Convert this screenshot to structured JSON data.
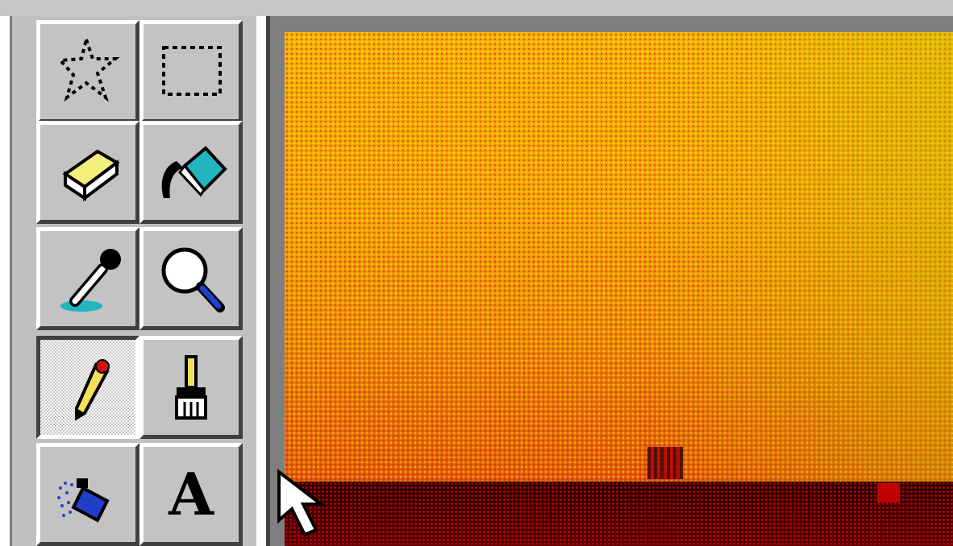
{
  "toolbox": {
    "tools": [
      {
        "name": "free-form-select",
        "icon": "free-form-select-icon",
        "selected": false
      },
      {
        "name": "rectangle-select",
        "icon": "rectangle-select-icon",
        "selected": false
      },
      {
        "name": "eraser",
        "icon": "eraser-icon",
        "selected": false
      },
      {
        "name": "fill-with-color",
        "icon": "paint-bucket-icon",
        "selected": false
      },
      {
        "name": "pick-color",
        "icon": "eyedropper-icon",
        "selected": false
      },
      {
        "name": "magnifier",
        "icon": "magnifier-icon",
        "selected": false
      },
      {
        "name": "pencil",
        "icon": "pencil-icon",
        "selected": true
      },
      {
        "name": "brush",
        "icon": "brush-icon",
        "selected": false
      },
      {
        "name": "airbrush",
        "icon": "airbrush-icon",
        "selected": false
      },
      {
        "name": "text",
        "icon": "text-icon",
        "label": "A",
        "selected": false
      }
    ]
  },
  "colors": {
    "face": "#c0c0c0",
    "highlight": "#ffffff",
    "shadow": "#404040",
    "canvas_top": "#f2b10a",
    "canvas_bottom": "#d8410e"
  },
  "pointer": {
    "icon": "arrow-cursor-icon"
  }
}
